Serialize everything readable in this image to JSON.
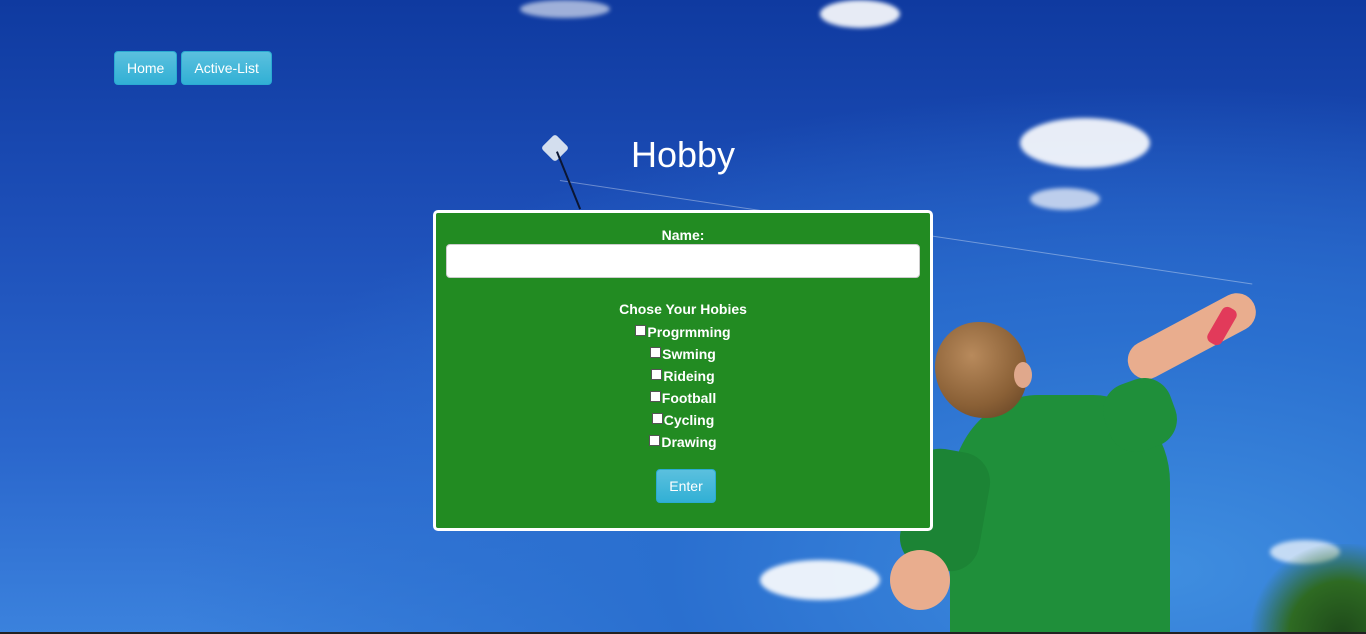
{
  "nav": {
    "home_label": "Home",
    "active_list_label": "Active-List"
  },
  "page_title": "Hobby",
  "form": {
    "name_label": "Name:",
    "name_value": "",
    "hobbies_heading": "Chose Your Hobies",
    "hobbies": [
      {
        "label": "Progrmming",
        "checked": false
      },
      {
        "label": "Swming",
        "checked": false
      },
      {
        "label": "Rideing",
        "checked": false
      },
      {
        "label": "Football",
        "checked": false
      },
      {
        "label": "Cycling",
        "checked": false
      },
      {
        "label": "Drawing",
        "checked": false
      }
    ],
    "submit_label": "Enter"
  },
  "colors": {
    "button_accent": "#5bc0de",
    "panel_background": "#228b22",
    "panel_border": "#ffffff",
    "sky": "#1d4fb8"
  }
}
